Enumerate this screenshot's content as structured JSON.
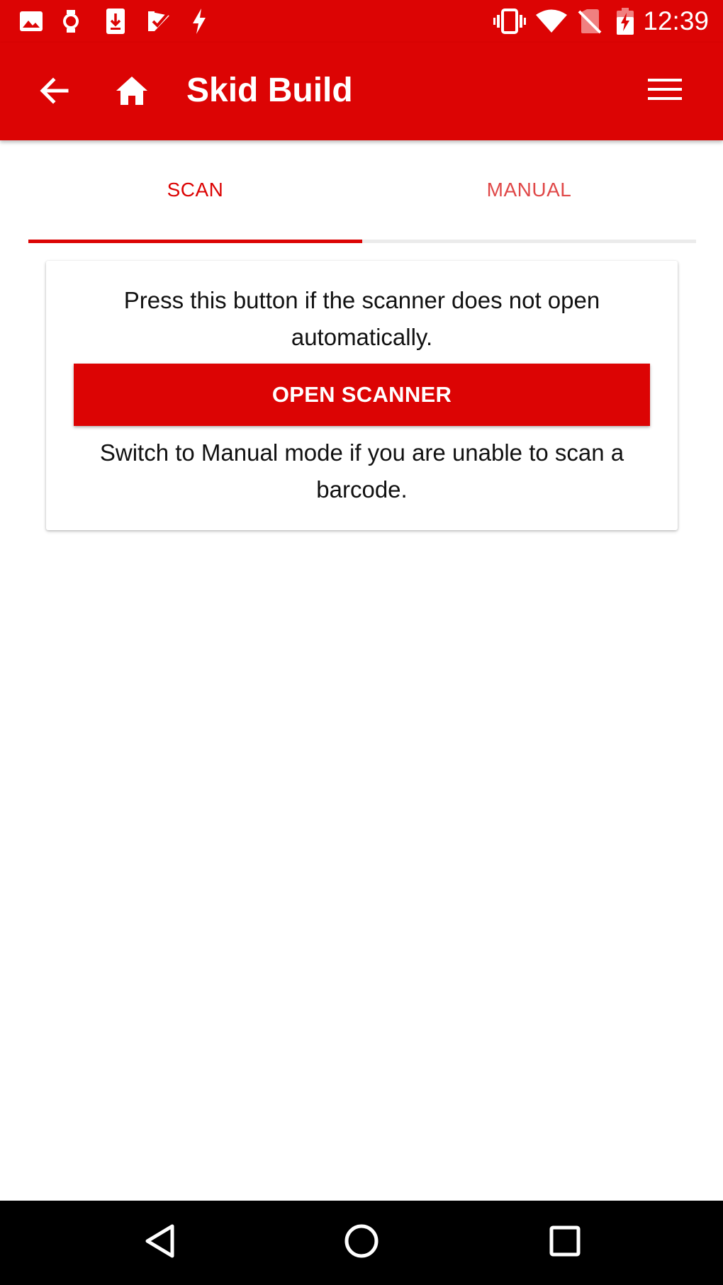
{
  "status_bar": {
    "time": "12:39",
    "left_icons": [
      "image-icon",
      "watch-icon",
      "download-icon",
      "checklist-icon",
      "flash-icon"
    ],
    "right_icons": [
      "vibrate-icon",
      "wifi-icon",
      "no-sim-icon",
      "battery-charging-icon"
    ]
  },
  "app_bar": {
    "title": "Skid Build",
    "background": "#dc0404"
  },
  "tabs": [
    {
      "label": "SCAN",
      "selected": true
    },
    {
      "label": "MANUAL",
      "selected": false
    }
  ],
  "card": {
    "instruction_top": "Press this button if the scanner does not open automatically.",
    "button_label": "OPEN SCANNER",
    "instruction_bottom": "Switch to Manual mode if you are unable to scan a barcode."
  },
  "nav_bar": {
    "buttons": [
      "back-icon",
      "home-icon",
      "recents-icon"
    ]
  },
  "colors": {
    "accent": "#dc0404",
    "tab_inactive": "#e04848",
    "nav_background": "#000000"
  }
}
